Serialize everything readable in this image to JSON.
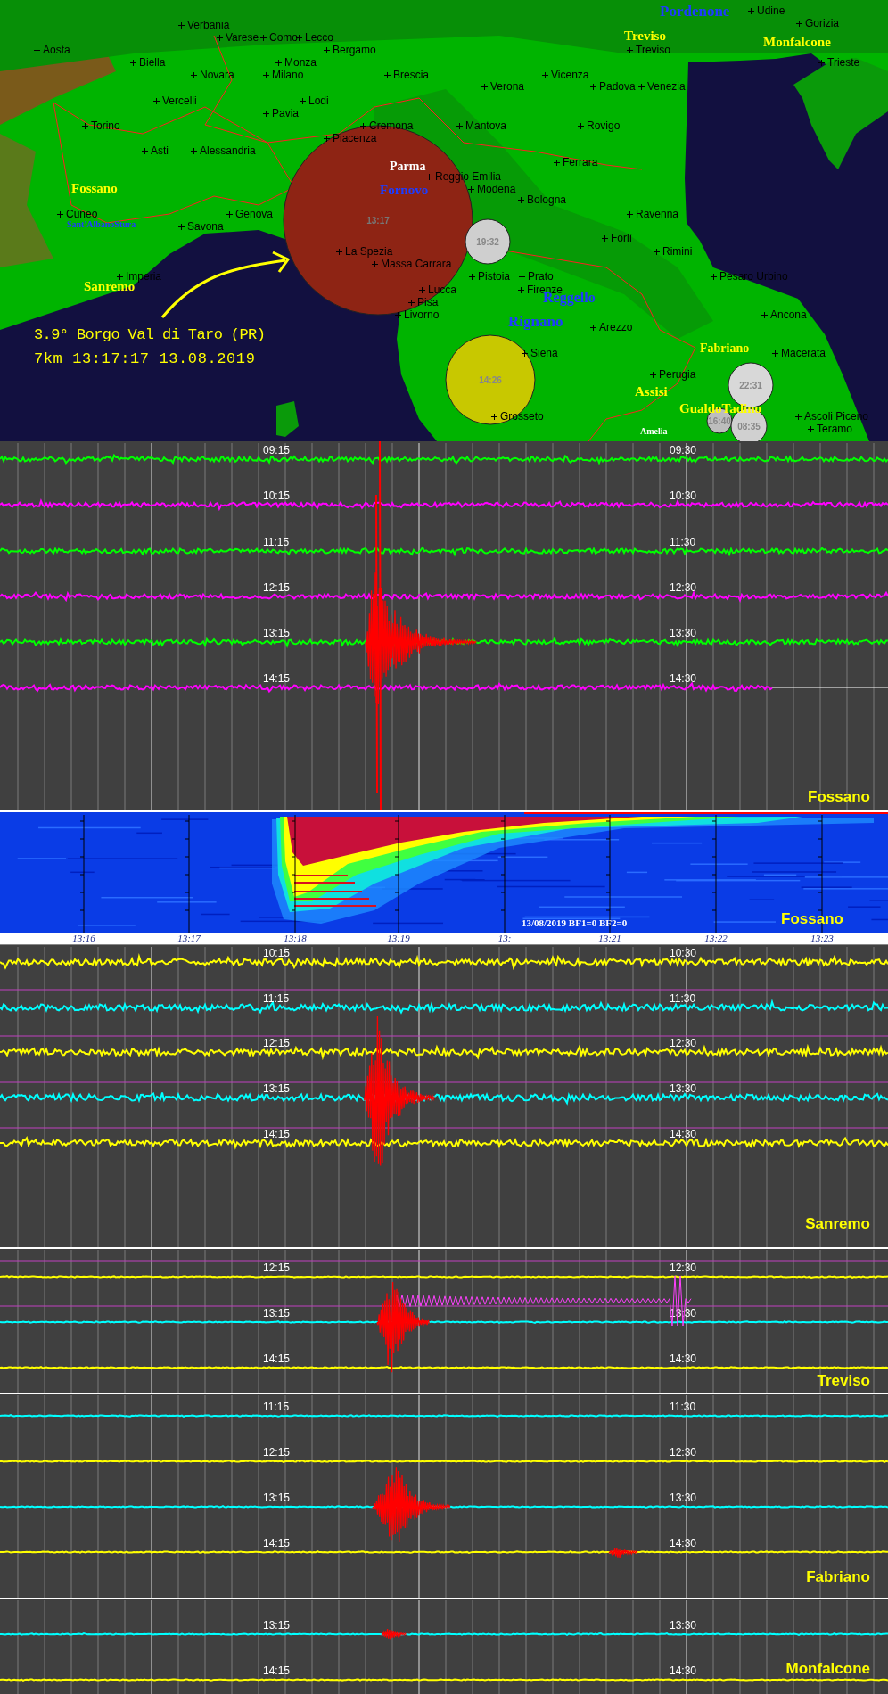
{
  "map": {
    "cities": [
      "Udine",
      "Gorizia",
      "Verbania",
      "Varese",
      "Como",
      "Lecco",
      "Aosta",
      "Bergamo",
      "Treviso",
      "Biella",
      "Monza",
      "Trieste",
      "Novara",
      "Milano",
      "Brescia",
      "Vicenza",
      "Verona",
      "Padova",
      "Venezia",
      "Vercelli",
      "Lodi",
      "Pavia",
      "Torino",
      "Cremona",
      "Mantova",
      "Rovigo",
      "Piacenza",
      "Asti",
      "Alessandria",
      "Ferrara",
      "Reggio Emilia",
      "Modena",
      "Bologna",
      "Cuneo",
      "Genova",
      "Ravenna",
      "Savona",
      "Forlì",
      "La Spezia",
      "Rimini",
      "Massa Carrara",
      "Imperia",
      "Pistoia",
      "Prato",
      "Pesaro Urbino",
      "Lucca",
      "Firenze",
      "Pisa",
      "Livorno",
      "Ancona",
      "Arezzo",
      "Siena",
      "Macerata",
      "Perugia",
      "Grosseto",
      "Ascoli Piceno",
      "Teramo"
    ],
    "stations": [
      {
        "name": "Pordenone",
        "color": "#1e3cff"
      },
      {
        "name": "Treviso",
        "color": "#ffff00"
      },
      {
        "name": "Monfalcone",
        "color": "#ffff00"
      },
      {
        "name": "Parma",
        "color": "#ffffff"
      },
      {
        "name": "Fossano",
        "color": "#ffff00"
      },
      {
        "name": "Fornovo",
        "color": "#1e3cff"
      },
      {
        "name": "Sant'AlbanoStura",
        "color": "#1e3cff"
      },
      {
        "name": "Sanremo",
        "color": "#ffff00"
      },
      {
        "name": "Reggello",
        "color": "#1e3cff"
      },
      {
        "name": "Rignano",
        "color": "#1e3cff"
      },
      {
        "name": "Fabriano",
        "color": "#ffff00"
      },
      {
        "name": "Assisi",
        "color": "#ffff00"
      },
      {
        "name": "GualdoTadino",
        "color": "#ffff00"
      },
      {
        "name": "Amelia",
        "color": "#ffffff"
      }
    ],
    "events": [
      {
        "time": "13:17",
        "color": "#8e2414"
      },
      {
        "time": "19:32",
        "color": "#cfcfcf"
      },
      {
        "time": "14:26",
        "color": "#c8c800"
      },
      {
        "time": "22:31",
        "color": "#d8d8d8"
      },
      {
        "time": "16:40",
        "color": "#bdbdbd"
      },
      {
        "time": "08:35",
        "color": "#d0d0d0"
      }
    ],
    "caption": [
      "3.9° Borgo Val di Taro (PR)",
      "7km 13:17:17 13.08.2019"
    ]
  },
  "panels": [
    {
      "kind": "helicorder",
      "station": "Fossano",
      "rows": [
        {
          "start": "09:15",
          "end": "09:30",
          "color": "#00ff00"
        },
        {
          "start": "10:15",
          "end": "10:30",
          "color": "#ff00ff"
        },
        {
          "start": "11:15",
          "end": "11:30",
          "color": "#00ff00"
        },
        {
          "start": "12:15",
          "end": "12:30",
          "color": "#ff00ff"
        },
        {
          "start": "13:15",
          "end": "13:30",
          "color": "#00ff00"
        },
        {
          "start": "14:15",
          "end": "14:30",
          "color": "#ff00ff"
        }
      ]
    },
    {
      "kind": "spectrogram",
      "station": "Fossano",
      "info": "13/08/2019 BF1=0 BF2=0",
      "time_axis": [
        "13:16",
        "13:17",
        "13:18",
        "13:19",
        "13:",
        "13:21",
        "13:22",
        "13:23"
      ]
    },
    {
      "kind": "helicorder",
      "station": "Sanremo",
      "rows": [
        {
          "start": "10:15",
          "end": "10:30",
          "color": "#ffff00"
        },
        {
          "start": "11:15",
          "end": "11:30",
          "color": "#00ffff"
        },
        {
          "start": "12:15",
          "end": "12:30",
          "color": "#ffff00"
        },
        {
          "start": "13:15",
          "end": "13:30",
          "color": "#00ffff"
        },
        {
          "start": "14:15",
          "end": "14:30",
          "color": "#ffff00"
        }
      ]
    },
    {
      "kind": "helicorder",
      "station": "Treviso",
      "rows": [
        {
          "start": "12:15",
          "end": "12:30",
          "color": "#ffff00"
        },
        {
          "start": "13:15",
          "end": "13:30",
          "color": "#00ffff"
        },
        {
          "start": "14:15",
          "end": "14:30",
          "color": "#ffff00"
        }
      ]
    },
    {
      "kind": "helicorder",
      "station": "Fabriano",
      "rows": [
        {
          "start": "11:15",
          "end": "11:30",
          "color": "#00ffff"
        },
        {
          "start": "12:15",
          "end": "12:30",
          "color": "#ffff00"
        },
        {
          "start": "13:15",
          "end": "13:30",
          "color": "#00ffff"
        },
        {
          "start": "14:15",
          "end": "14:30",
          "color": "#ffff00"
        }
      ]
    },
    {
      "kind": "helicorder",
      "station": "Monfalcone",
      "rows": [
        {
          "start": "13:15",
          "end": "13:30",
          "color": "#00ffff"
        },
        {
          "start": "14:15",
          "end": "14:30",
          "color": "#ffff00"
        }
      ]
    }
  ]
}
